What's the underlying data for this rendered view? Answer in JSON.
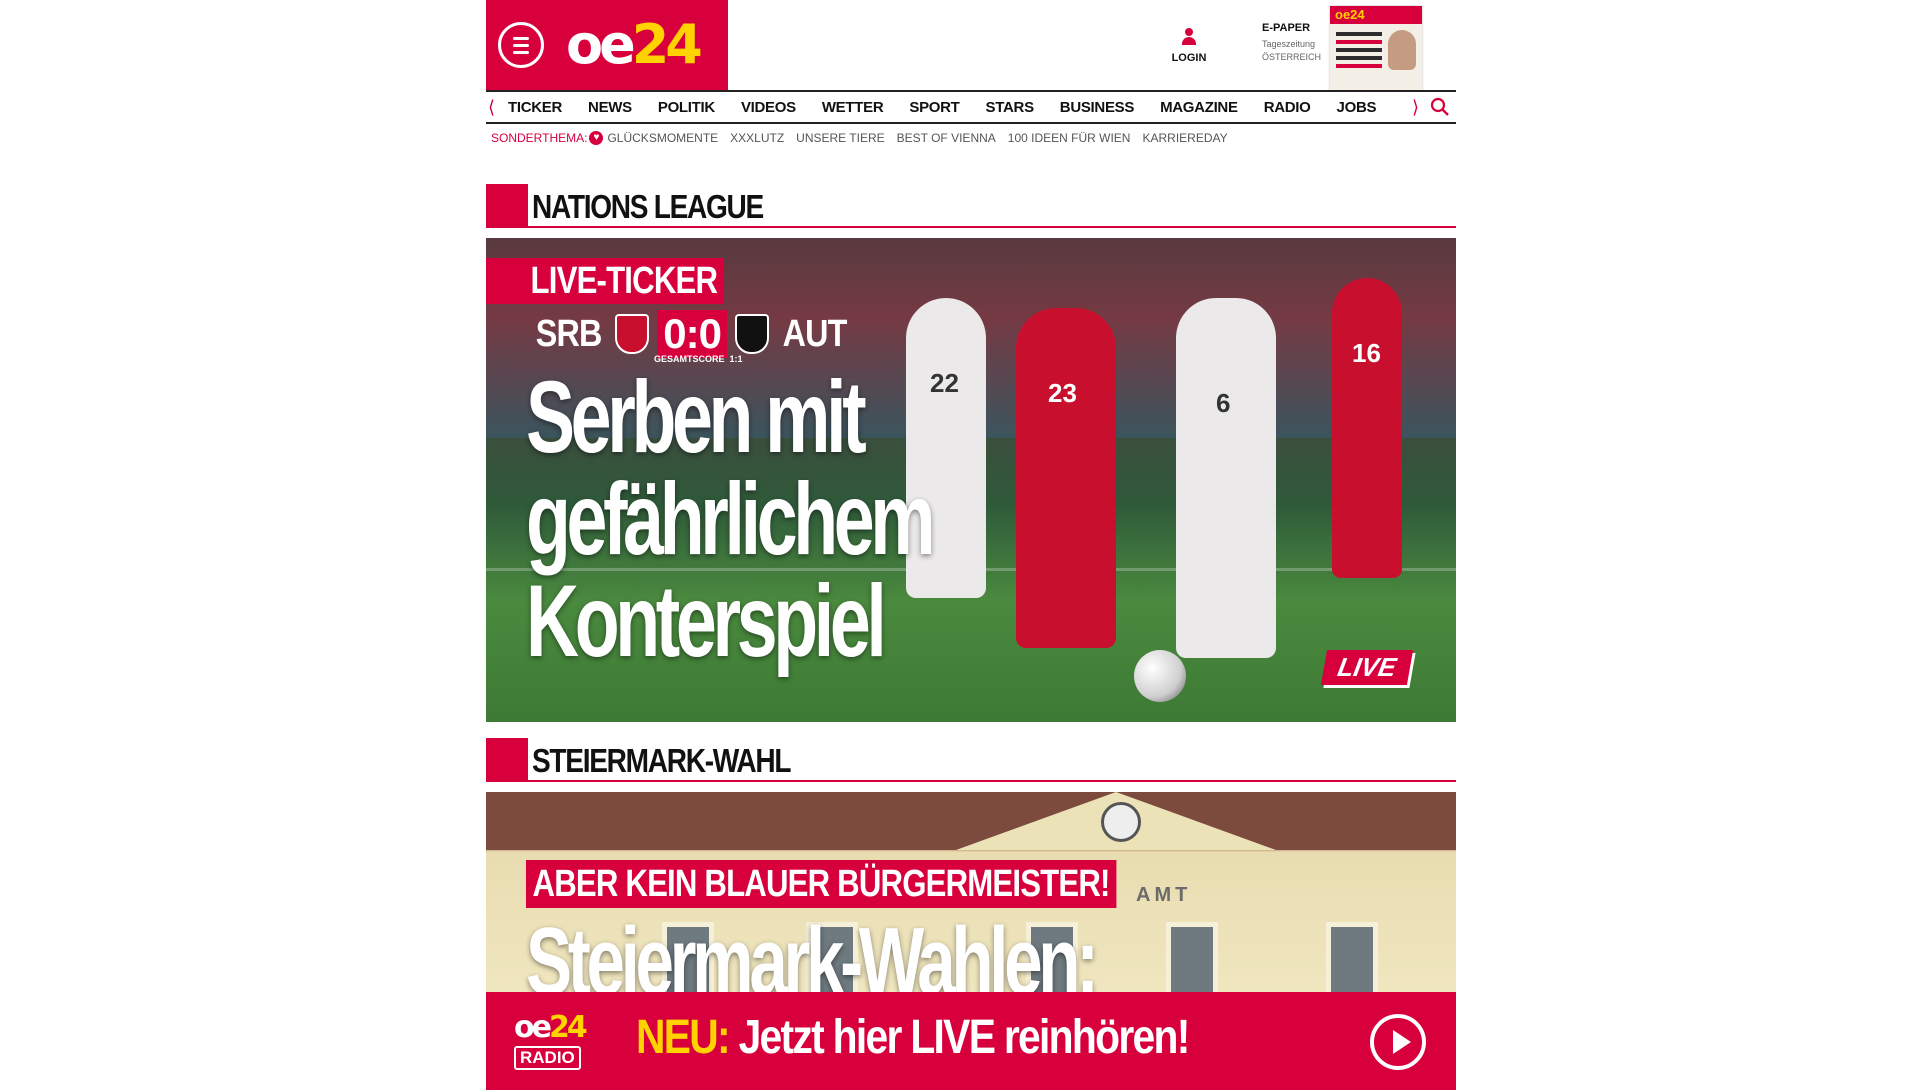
{
  "header": {
    "logo": {
      "part1": "oe",
      "part2": "24"
    },
    "login_label": "LOGIN",
    "epaper": {
      "title": "E-PAPER",
      "line1": "Tageszeitung",
      "line2": "ÖSTERREICH"
    }
  },
  "nav": {
    "items": [
      "TICKER",
      "NEWS",
      "POLITIK",
      "VIDEOS",
      "WETTER",
      "SPORT",
      "STARS",
      "BUSINESS",
      "MAGAZINE",
      "RADIO",
      "JOBS"
    ],
    "prev_icon": "chevron-left-icon",
    "next_icon": "chevron-right-icon",
    "search_icon": "search-icon"
  },
  "subnav": {
    "label": "SONDERTHEMA:",
    "items": [
      "GLÜCKSMOMENTE",
      "XXXLUTZ",
      "UNSERE TIERE",
      "BEST OF VIENNA",
      "100 IDEEN FÜR WIEN",
      "KARRIEREDAY"
    ]
  },
  "sections": [
    {
      "title": "NATIONS LEAGUE",
      "tag": "LIVE-TICKER",
      "score": {
        "home": "SRB",
        "result": "0:0",
        "away": "AUT",
        "aggregate_label": "GESAMTSCORE",
        "aggregate_value": "1:1"
      },
      "headline": "Serben mit gefährlichem Konterspiel",
      "badge": "LIVE"
    },
    {
      "title": "STEIERMARK-WAHL",
      "tag": "ABER KEIN BLAUER BÜRGERMEISTER!",
      "headline": "Steiermark-Wahlen:",
      "building_text": "AMT"
    }
  ],
  "radio_banner": {
    "logo_part1": "oe",
    "logo_part2": "24",
    "logo_box": "RADIO",
    "highlight": "NEU:",
    "text": "Jetzt hier LIVE reinhören!"
  },
  "colors": {
    "brand_red": "#d7003c",
    "brand_yellow": "#ffd200"
  }
}
